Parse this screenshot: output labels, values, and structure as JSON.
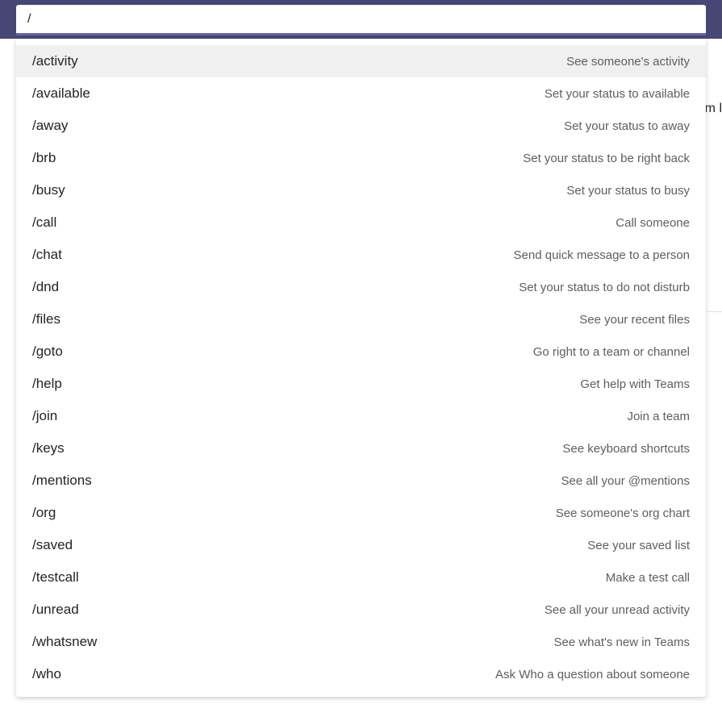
{
  "search": {
    "value": "/"
  },
  "background": {
    "partial_text": "m l"
  },
  "commands": [
    {
      "name": "/activity",
      "desc": "See someone's activity",
      "selected": true
    },
    {
      "name": "/available",
      "desc": "Set your status to available",
      "selected": false
    },
    {
      "name": "/away",
      "desc": "Set your status to away",
      "selected": false
    },
    {
      "name": "/brb",
      "desc": "Set your status to be right back",
      "selected": false
    },
    {
      "name": "/busy",
      "desc": "Set your status to busy",
      "selected": false
    },
    {
      "name": "/call",
      "desc": "Call someone",
      "selected": false
    },
    {
      "name": "/chat",
      "desc": "Send quick message to a person",
      "selected": false
    },
    {
      "name": "/dnd",
      "desc": "Set your status to do not disturb",
      "selected": false
    },
    {
      "name": "/files",
      "desc": "See your recent files",
      "selected": false
    },
    {
      "name": "/goto",
      "desc": "Go right to a team or channel",
      "selected": false
    },
    {
      "name": "/help",
      "desc": "Get help with Teams",
      "selected": false
    },
    {
      "name": "/join",
      "desc": "Join a team",
      "selected": false
    },
    {
      "name": "/keys",
      "desc": "See keyboard shortcuts",
      "selected": false
    },
    {
      "name": "/mentions",
      "desc": "See all your @mentions",
      "selected": false
    },
    {
      "name": "/org",
      "desc": "See someone's org chart",
      "selected": false
    },
    {
      "name": "/saved",
      "desc": "See your saved list",
      "selected": false
    },
    {
      "name": "/testcall",
      "desc": "Make a test call",
      "selected": false
    },
    {
      "name": "/unread",
      "desc": "See all your unread activity",
      "selected": false
    },
    {
      "name": "/whatsnew",
      "desc": "See what's new in Teams",
      "selected": false
    },
    {
      "name": "/who",
      "desc": "Ask Who a question about someone",
      "selected": false
    }
  ]
}
